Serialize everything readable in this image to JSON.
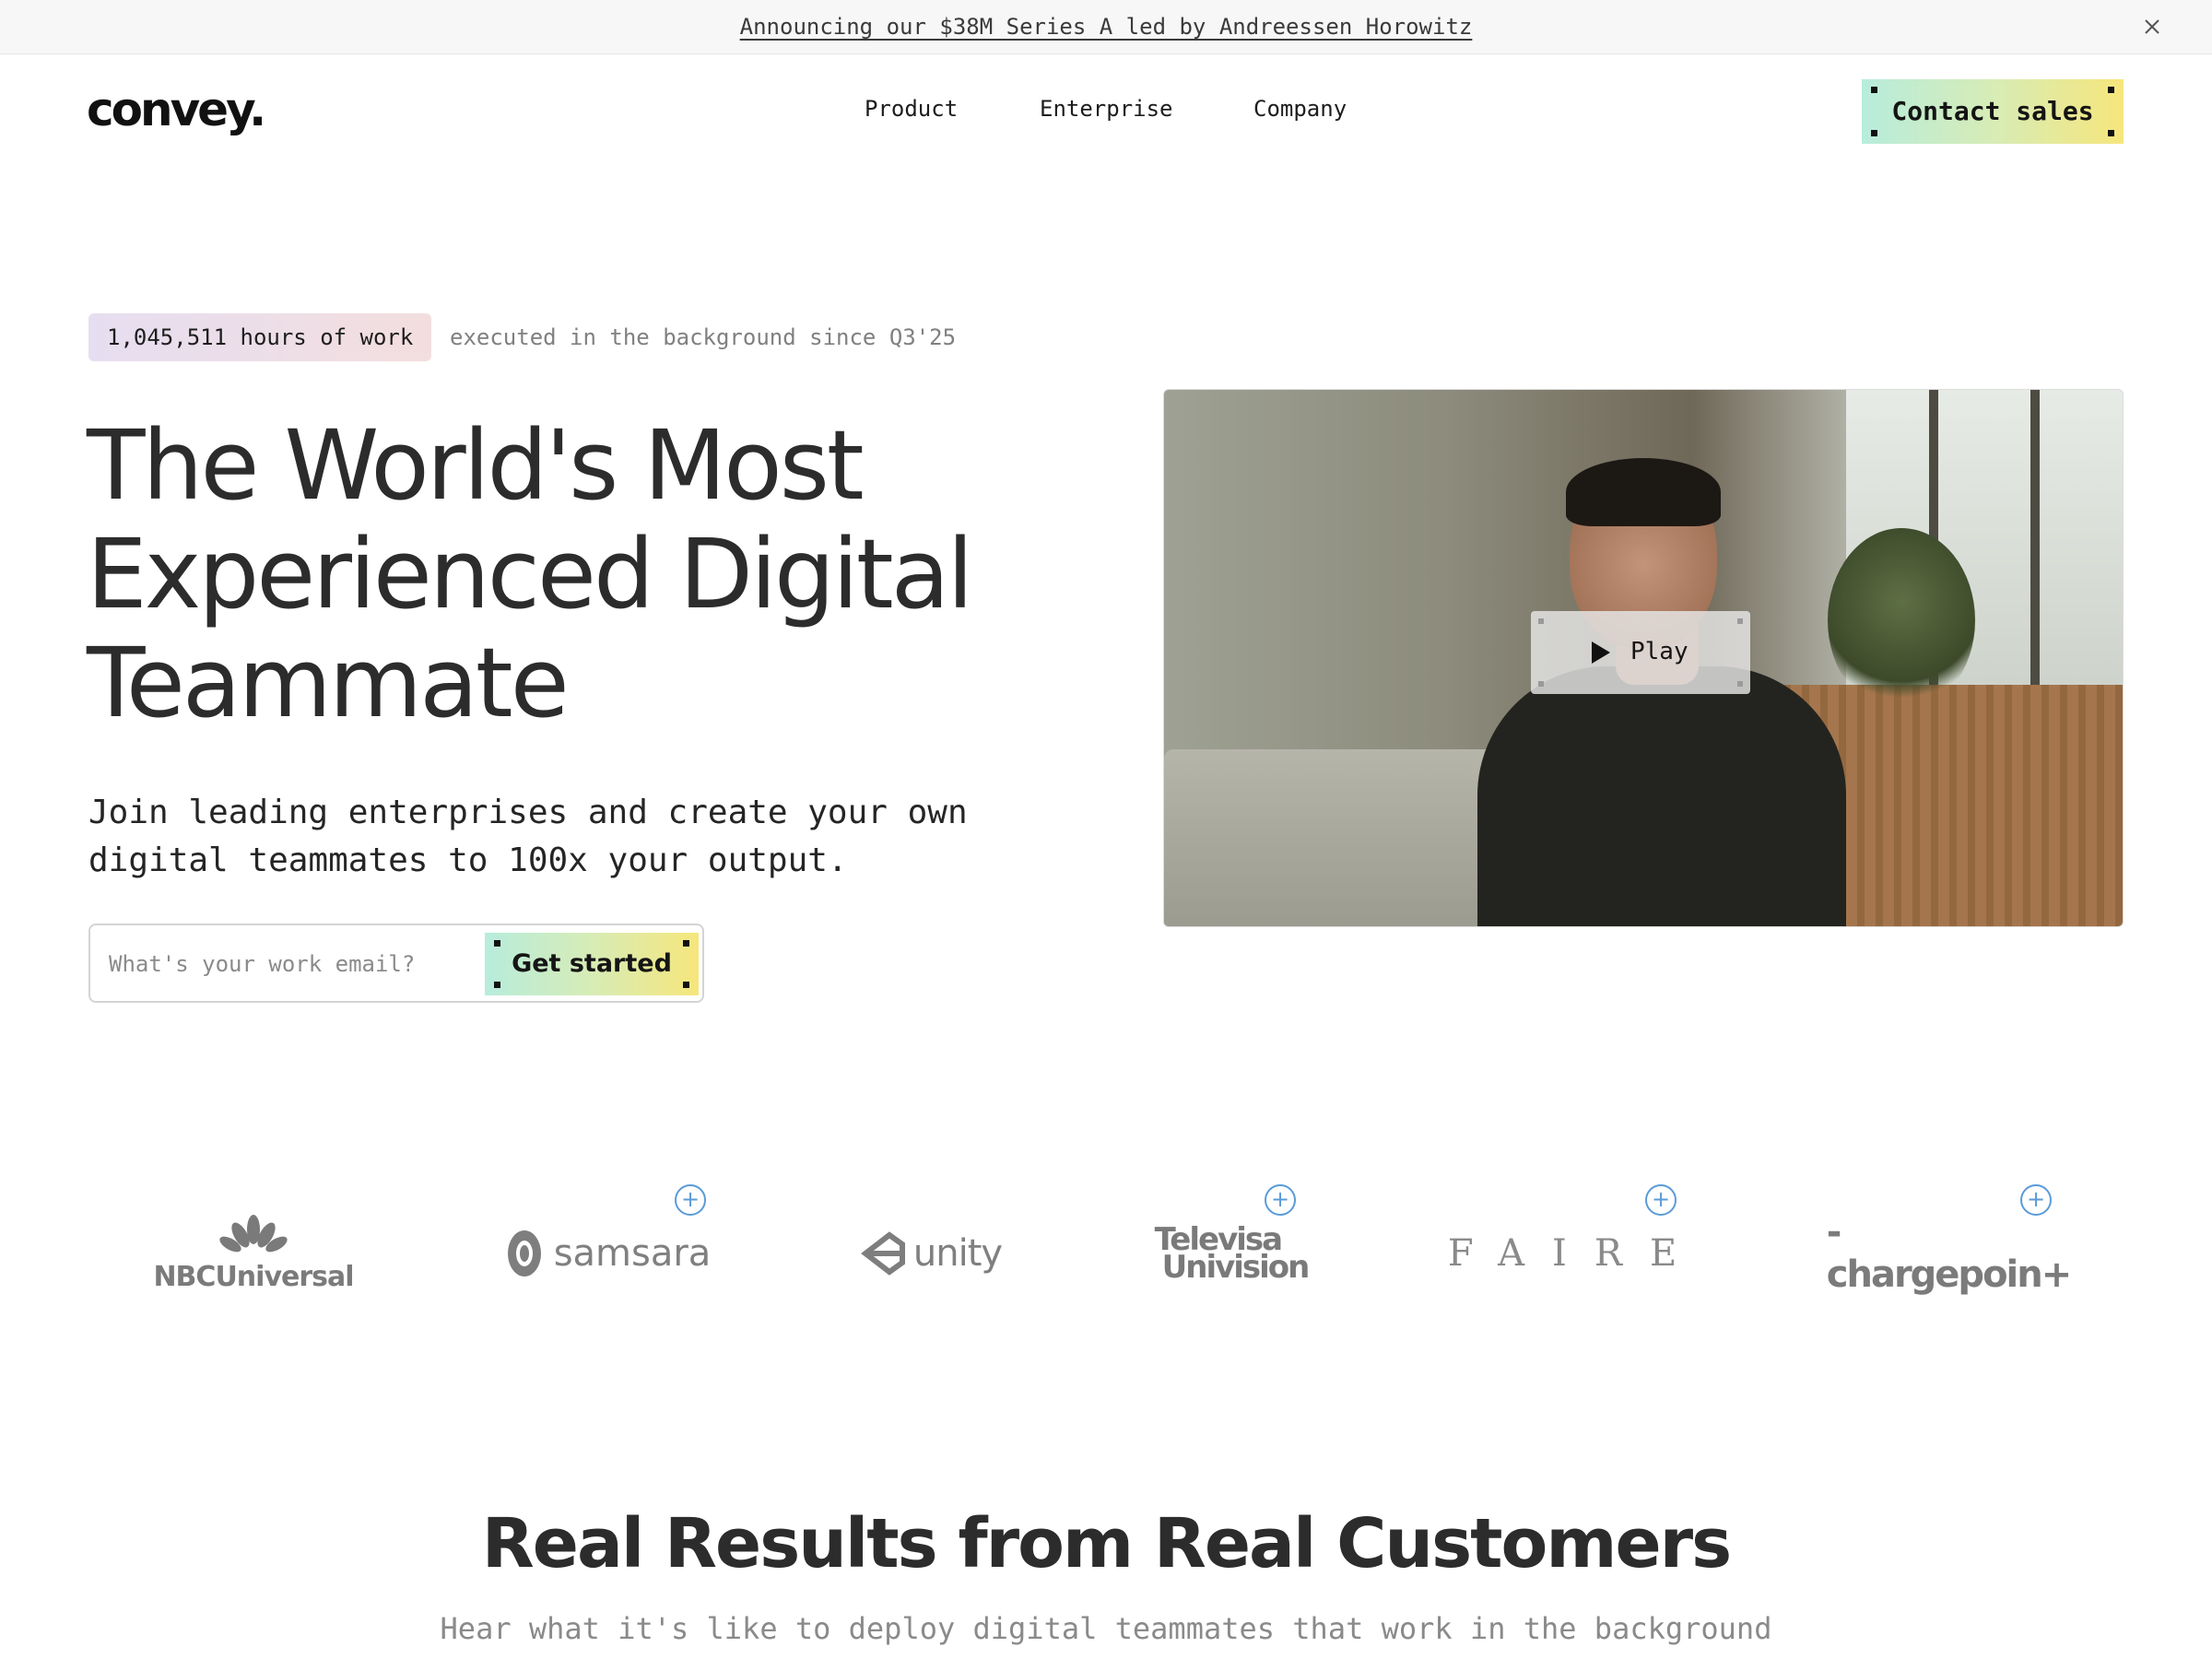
{
  "announcement": {
    "text": "Announcing our $38M Series A led by Andreessen Horowitz",
    "close_icon": "close-icon"
  },
  "header": {
    "logo": "convey.",
    "nav": [
      {
        "label": "Product"
      },
      {
        "label": "Enterprise"
      },
      {
        "label": "Company"
      }
    ],
    "contact_label": "Contact sales"
  },
  "hero": {
    "stat_badge": "1,045,511 hours of work",
    "stat_rest": "executed in the background since Q3'25",
    "title_lines": [
      "The World's Most",
      "Experienced Digital",
      "Teammate"
    ],
    "subtitle": "Join leading enterprises and create your own digital teammates to 100x your output.",
    "email_placeholder": "What's your work email?",
    "email_value": "",
    "cta_label": "Get started"
  },
  "video": {
    "play_label": "Play",
    "play_icon": "play-icon"
  },
  "customer_logos": [
    {
      "name": "NBCUniversal",
      "text": "NBCUniversal"
    },
    {
      "name": "samsara",
      "text": "samsara"
    },
    {
      "name": "unity",
      "text": "unity"
    },
    {
      "name": "Televisa Univision",
      "text_lines": [
        "Televisa",
        "Univision"
      ]
    },
    {
      "name": "FAIRE",
      "text": "FAIRE"
    },
    {
      "name": "chargepoint",
      "text": "-chargepoin+"
    }
  ],
  "results": {
    "title": "Real Results from Real Customers",
    "subtitle": "Hear what it's like to deploy digital teammates that work in the background"
  },
  "colors": {
    "accent_gradient_start": "#b7ecdc",
    "accent_gradient_end": "#f6e67c",
    "plus_icon": "#5a9bd8"
  }
}
